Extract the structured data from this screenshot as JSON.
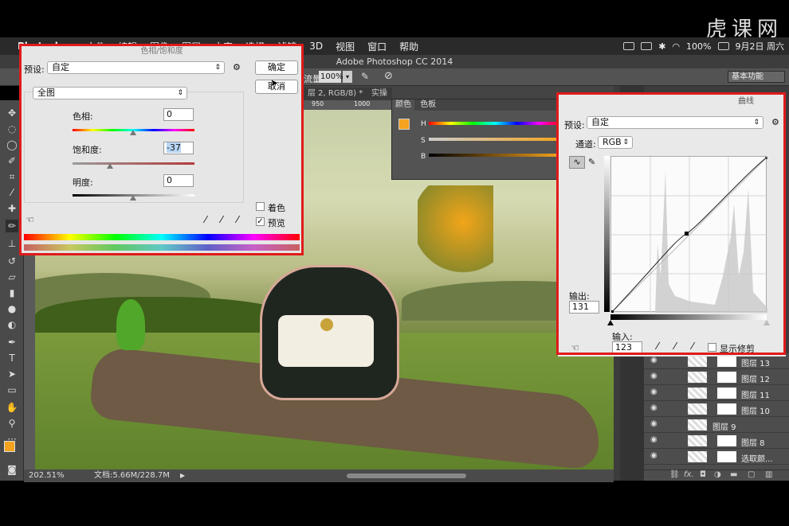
{
  "menubar": {
    "app_name": "Photoshop",
    "items": [
      "文件",
      "编辑",
      "图像",
      "图层",
      "文字",
      "选择",
      "滤镜",
      "3D",
      "视图",
      "窗口",
      "帮助"
    ],
    "battery": "100%",
    "date": "9月2日 周六"
  },
  "watermark": "虎课网",
  "window_title": "Adobe Photoshop CC 2014",
  "options_bar": {
    "flow_label": "流量:",
    "flow_value": "100%",
    "workspace": "基本功能"
  },
  "document_tabs": [
    "层 2, RGB/8) *",
    "实操"
  ],
  "ruler_top_labels": [
    "950",
    "1000"
  ],
  "status_bar": {
    "zoom": "202.51%",
    "doc_info": "文档:5.66M/228.7M"
  },
  "color_panel": {
    "tabs": [
      "颜色",
      "色板"
    ],
    "labels": [
      "H",
      "S",
      "B"
    ],
    "foreground_color": "#f4a31e"
  },
  "hue_saturation": {
    "title": "色相/饱和度",
    "preset_label": "预设:",
    "preset_value": "自定",
    "range_value": "全图",
    "ok_label": "确定",
    "cancel_label": "取消",
    "hue_label": "色相:",
    "hue_value": "0",
    "saturation_label": "饱和度:",
    "saturation_value": "-37",
    "lightness_label": "明度:",
    "lightness_value": "0",
    "colorize_label": "着色",
    "colorize_checked": false,
    "preview_label": "预览",
    "preview_checked": true
  },
  "curves": {
    "title": "曲线",
    "preset_label": "预设:",
    "preset_value": "自定",
    "channel_label": "通道:",
    "channel_value": "RGB",
    "output_label": "输出:",
    "output_value": "131",
    "input_label": "输入:",
    "input_value": "123",
    "show_clipping_label": "显示修剪"
  },
  "layers": [
    {
      "name": "图层 13"
    },
    {
      "name": "图层 12"
    },
    {
      "name": "图层 11"
    },
    {
      "name": "图层 10"
    },
    {
      "name": "图层 9"
    },
    {
      "name": "图层 8"
    },
    {
      "name": "选取颜..."
    }
  ],
  "colors": {
    "highlight_frame": "#e11a1a",
    "accent_orange": "#f4a31e"
  }
}
